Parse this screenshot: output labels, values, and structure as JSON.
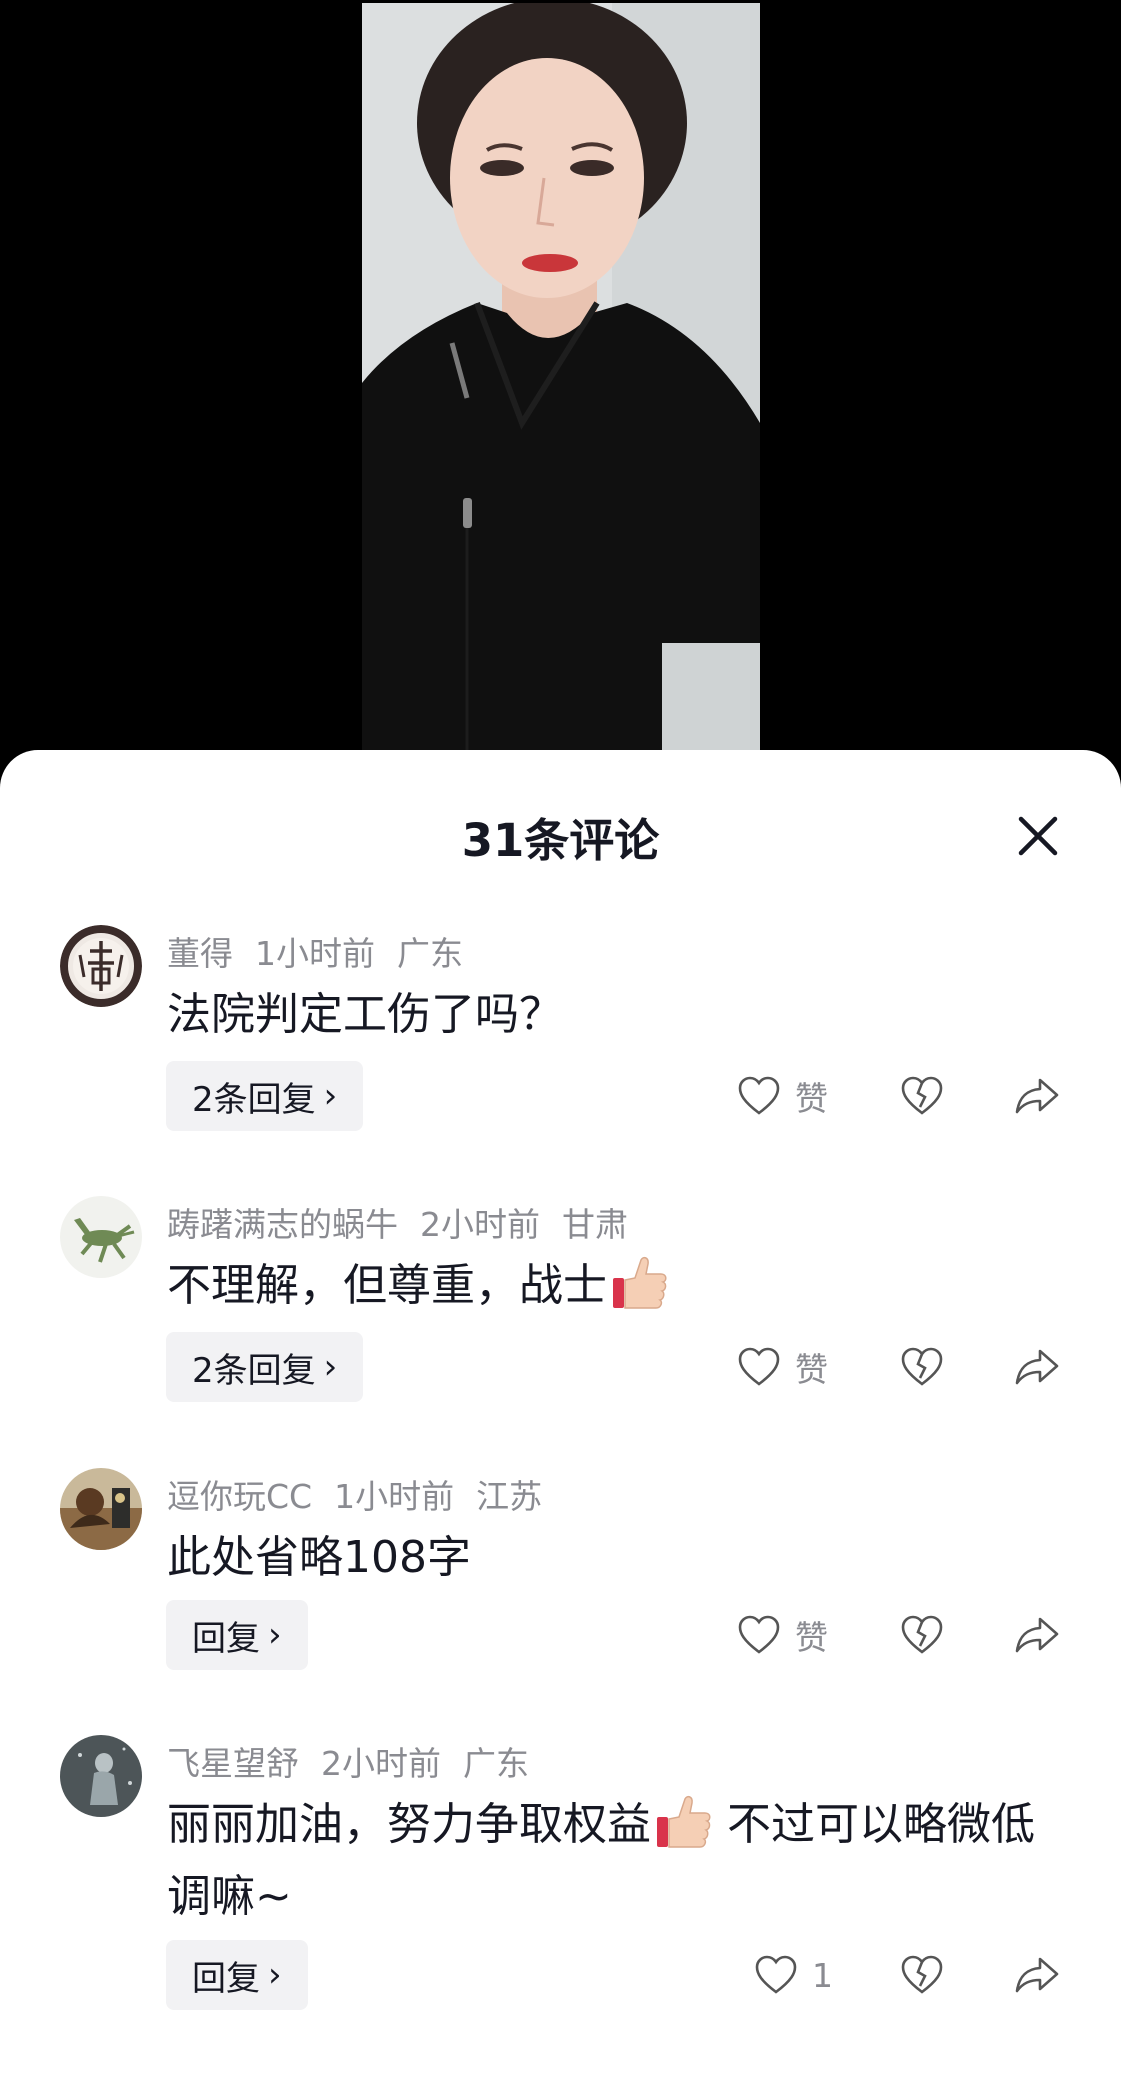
{
  "sheet": {
    "title": "31条评论"
  },
  "comments": [
    {
      "username": "董得",
      "time": "1小时前",
      "location": "广东",
      "text": "法院判定工伤了吗？",
      "reply_label": "2条回复",
      "like_label": "赞",
      "avatar_icon": "emblem-seal-avatar"
    },
    {
      "username": "踌躇满志的蜗牛",
      "time": "2小时前",
      "location": "甘肃",
      "text": "不理解，但尊重，战士",
      "emoji": "thumbs-up",
      "reply_label": "2条回复",
      "like_label": "赞",
      "avatar_icon": "bronze-horse-avatar"
    },
    {
      "username": "逗你玩CC",
      "time": "1小时前",
      "location": "江苏",
      "text": "此处省略108字",
      "reply_label": "回复",
      "like_label": "赞",
      "avatar_icon": "painting-avatar"
    },
    {
      "username": "飞星望舒",
      "time": "2小时前",
      "location": "广东",
      "text_part1": "丽丽加油，努力争取权益",
      "text_part2": " 不过可以略微低调嘛~",
      "emoji": "thumbs-up",
      "reply_label": "回复",
      "like_label": "1",
      "avatar_icon": "figure-avatar"
    }
  ],
  "colors": {
    "text_primary": "#161823",
    "text_secondary": "#8a8b91",
    "reply_bg": "#f2f2f4"
  }
}
